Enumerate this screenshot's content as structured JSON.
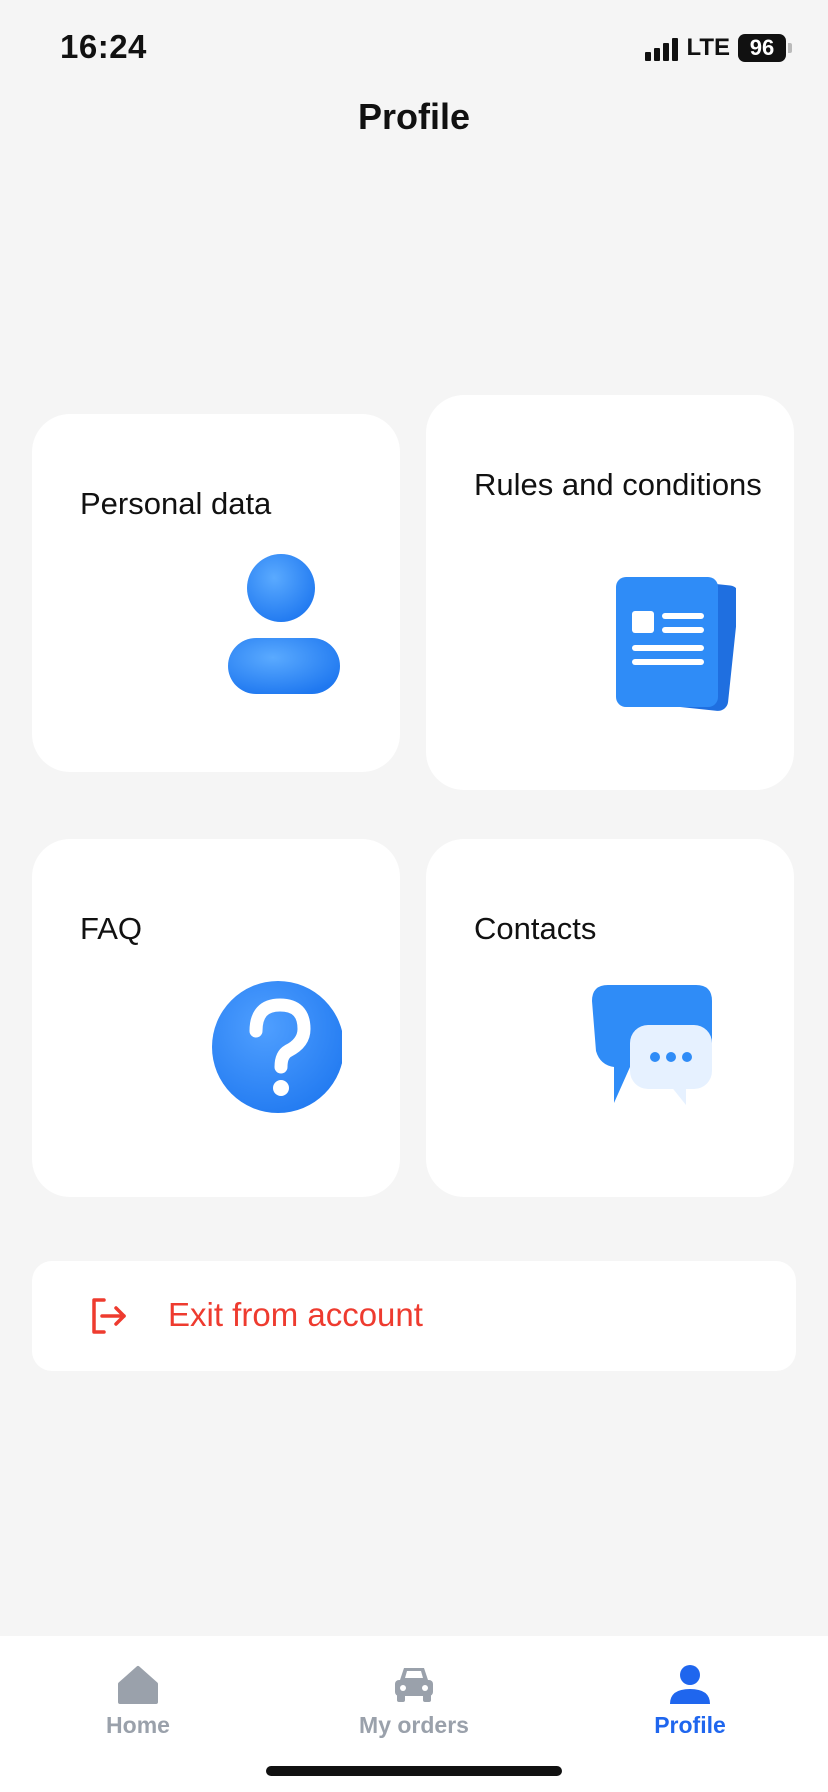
{
  "status": {
    "time": "16:24",
    "network": "LTE",
    "battery": "96"
  },
  "header": {
    "title": "Profile"
  },
  "cards": [
    {
      "label": "Personal data",
      "icon": "person-icon"
    },
    {
      "label": "Rules and conditions",
      "icon": "document-icon"
    },
    {
      "label": "FAQ",
      "icon": "question-icon"
    },
    {
      "label": "Contacts",
      "icon": "chat-icon"
    }
  ],
  "exit": {
    "label": "Exit from account",
    "icon": "logout-icon",
    "color": "#ee3b2f"
  },
  "tabbar": {
    "items": [
      {
        "label": "Home",
        "icon": "home-icon",
        "active": false
      },
      {
        "label": "My orders",
        "icon": "car-icon",
        "active": false
      },
      {
        "label": "Profile",
        "icon": "person-icon",
        "active": true
      }
    ],
    "active_color": "#1f66ee",
    "inactive_color": "#9aa1ab"
  },
  "colors": {
    "accent": "#2f8cf7",
    "background": "#f5f5f5"
  }
}
